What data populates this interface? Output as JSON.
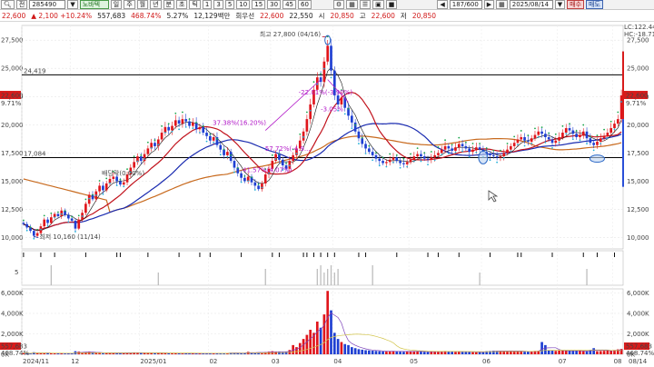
{
  "toolbar": {
    "search_icon": "magnifier-icon",
    "market_label": "전",
    "code_value": "285490",
    "name_value": "노바텍",
    "period_tabs": [
      "주",
      "월",
      "년",
      "분",
      "초",
      "틱"
    ],
    "interval_tabs": [
      "1",
      "3",
      "5",
      "10",
      "15",
      "30",
      "45",
      "60"
    ],
    "count_value": "187/600",
    "date_value": "2025/08/14",
    "buy_label": "매수",
    "sell_label": "매도"
  },
  "quote": {
    "price": "22,600",
    "change": "▲ 2,100 +10.24%",
    "volume": "557,683",
    "vol_ratio": "468.74%",
    "turnover_pct": "5.27%",
    "amount": "12,129백만",
    "extra": "회우선",
    "open_label": "22,600",
    "price2": "22,550",
    "high_label": "시",
    "high_value": "20,850",
    "low_label": "고",
    "low_value": "22,600",
    "low2_label": "저",
    "low2_value": "20,850"
  },
  "chart_data": {
    "type": "candlestick",
    "x_labels": [
      "2024/11",
      "12",
      "2025/01",
      "02",
      "03",
      "04",
      "05",
      "06",
      "07",
      "08",
      "08/14"
    ],
    "price_axis_ticks": [
      "27,500",
      "25,000",
      "22,500",
      "20,000",
      "17,500",
      "15,000",
      "12,500",
      "10,000"
    ],
    "price_range": [
      9000,
      28800
    ],
    "ma_labels": [
      "LC:122.44",
      "HC:-18.71"
    ],
    "current_price_tag": "22,600",
    "current_pct_tag": "9.71%",
    "hlines": [
      {
        "label": "24,419",
        "value": 24419
      },
      {
        "label": "17,084",
        "value": 17084
      }
    ],
    "annotations": {
      "high": "최고 27,800 (04/16)",
      "low": "최저 10,160 (11/14)",
      "dividend": "배당락(0.00%)",
      "a1": "37.38%(16.20%)",
      "a2": "-22.01%(-3.90%)",
      "a3": "57.72%(-4.9...",
      "a4": "41.57%(4.07%)",
      "a5": "-3.05%"
    },
    "closes": [
      11200,
      10900,
      10600,
      10160,
      10400,
      11000,
      11600,
      11300,
      11800,
      12100,
      11900,
      12400,
      12000,
      11700,
      11500,
      10800,
      11600,
      12200,
      13000,
      13800,
      13400,
      14100,
      14600,
      14200,
      14800,
      15200,
      15400,
      15000,
      14700,
      14900,
      15600,
      16200,
      16700,
      17200,
      16800,
      17400,
      17900,
      18400,
      18100,
      18700,
      19300,
      19800,
      19500,
      19900,
      20400,
      20100,
      20500,
      20300,
      19900,
      20200,
      19600,
      19800,
      19300,
      19000,
      18600,
      18900,
      18200,
      17800,
      17300,
      17600,
      16800,
      16200,
      15700,
      15300,
      15000,
      15400,
      14900,
      14600,
      14300,
      14800,
      15600,
      16100,
      16800,
      17400,
      16900,
      16400,
      16100,
      16800,
      17300,
      17900,
      18600,
      19400,
      20500,
      21800,
      23100,
      24200,
      23800,
      25600,
      27000,
      24800,
      22600,
      21800,
      22400,
      21500,
      20800,
      20200,
      19400,
      18800,
      18300,
      17900,
      17600,
      17300,
      17000,
      16800,
      16600,
      16700,
      16900,
      17100,
      16800,
      16600,
      16500,
      16700,
      16900,
      17200,
      17400,
      17200,
      17000,
      16900,
      17100,
      17300,
      17500,
      17800,
      18100,
      17900,
      17700,
      18000,
      18300,
      18100,
      17900,
      17600,
      17800,
      18000,
      17800,
      17600,
      17400,
      17300,
      17200,
      17100,
      17200,
      17500,
      17800,
      18100,
      18400,
      18700,
      18900,
      18600,
      18500,
      18800,
      19100,
      19400,
      19200,
      18900,
      18700,
      18400,
      18600,
      18900,
      19300,
      19700,
      19500,
      19200,
      18900,
      19100,
      19400,
      18800,
      18400,
      18200,
      18500,
      18800,
      19000,
      19300,
      19700,
      20100,
      20500,
      22600
    ],
    "volume_axis_ticks": [
      "6,000K",
      "4,000K",
      "2,000K",
      "0K"
    ],
    "volume_max": 6400,
    "volume_tag": "557,683",
    "volume_pct_tag": "468.74%",
    "volumes": [
      120,
      90,
      80,
      200,
      150,
      110,
      100,
      90,
      120,
      95,
      85,
      100,
      80,
      90,
      110,
      300,
      260,
      180,
      220,
      240,
      160,
      150,
      140,
      110,
      120,
      130,
      90,
      85,
      100,
      150,
      140,
      160,
      180,
      130,
      120,
      140,
      150,
      160,
      110,
      130,
      140,
      120,
      90,
      100,
      110,
      90,
      80,
      95,
      85,
      90,
      80,
      85,
      90,
      100,
      110,
      95,
      90,
      120,
      130,
      110,
      150,
      140,
      120,
      110,
      130,
      240,
      180,
      160,
      170,
      150,
      220,
      260,
      300,
      250,
      230,
      200,
      260,
      420,
      900,
      700,
      1100,
      1500,
      1900,
      2400,
      2100,
      3200,
      2600,
      3900,
      6200,
      4300,
      2100,
      1500,
      1200,
      1000,
      900,
      700,
      600,
      500,
      450,
      400,
      380,
      350,
      330,
      300,
      280,
      260,
      300,
      320,
      280,
      260,
      250,
      270,
      300,
      310,
      280,
      260,
      240,
      230,
      250,
      270,
      260,
      300,
      320,
      280,
      260,
      240,
      250,
      270,
      230,
      220,
      210,
      200,
      230,
      250,
      300,
      320,
      350,
      330,
      300,
      320,
      340,
      360,
      310,
      290,
      280,
      260,
      270,
      300,
      330,
      340,
      1200,
      900,
      400,
      350,
      330,
      360,
      380,
      350,
      330,
      310,
      340,
      380,
      300,
      280,
      400,
      600,
      300,
      320,
      340,
      360,
      380,
      420,
      480,
      520
    ]
  },
  "signal_axis_tick": "5"
}
